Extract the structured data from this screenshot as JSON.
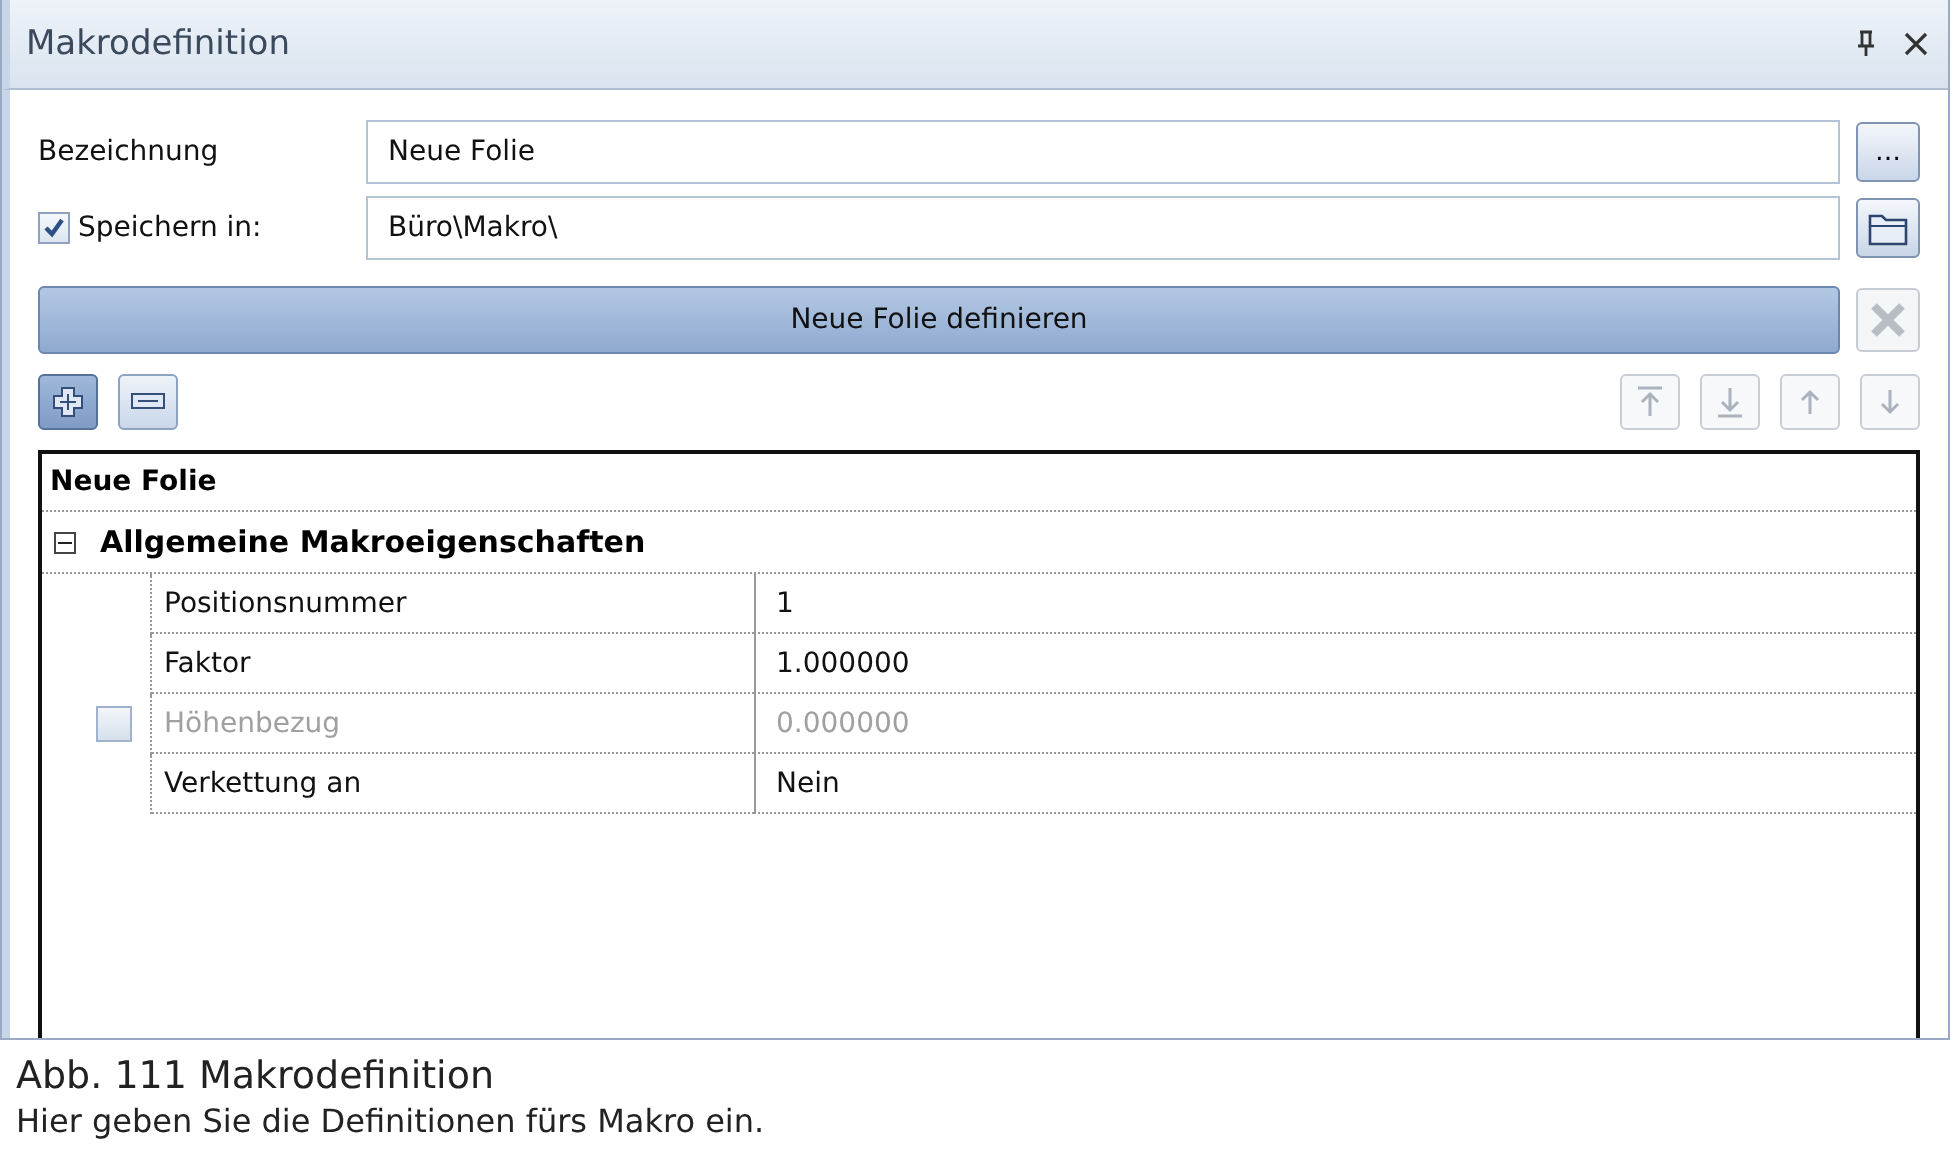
{
  "panel": {
    "title": "Makrodefinition"
  },
  "fields": [
    {
      "kind": "text",
      "label": "Bezeichnung",
      "value": "Neue Folie",
      "button": "…"
    },
    {
      "kind": "checkbox",
      "label": "Speichern in:",
      "checked": true,
      "value": "Büro\\Makro\\"
    }
  ],
  "define_button": {
    "label": "Neue Folie definieren"
  },
  "delete_button": {
    "disabled": true
  },
  "toolbar_left": [
    {
      "kind": "add",
      "pressed": true
    },
    {
      "kind": "remove",
      "pressed": false
    }
  ],
  "toolbar_right": [
    {
      "kind": "top",
      "disabled": true
    },
    {
      "kind": "bottom",
      "disabled": true
    },
    {
      "kind": "up",
      "disabled": true
    },
    {
      "kind": "down",
      "disabled": true
    }
  ],
  "grid": {
    "title": "Neue Folie",
    "category": {
      "label": "Allgemeine Makroeigenschaften",
      "expanded": true,
      "properties": [
        {
          "label": "Positionsnummer",
          "value": "1",
          "disabled": false
        },
        {
          "label": "Faktor",
          "value": "1.000000",
          "disabled": false
        },
        {
          "label": "Höhenbezug",
          "value": "0.000000",
          "disabled": true,
          "checkbox": {
            "checked": false
          }
        },
        {
          "label": "Verkettung an",
          "value": "Nein",
          "disabled": false
        }
      ]
    }
  },
  "caption": {
    "title": "Abb. 111 Makrodefinition",
    "text": "Hier geben Sie die Definitionen fürs Makro ein."
  }
}
